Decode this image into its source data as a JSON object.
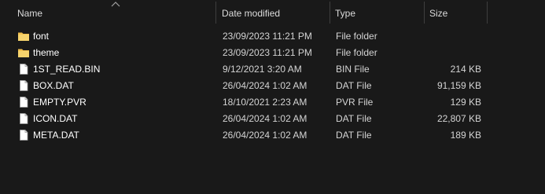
{
  "columns": {
    "name": "Name",
    "date": "Date modified",
    "type": "Type",
    "size": "Size"
  },
  "sort": {
    "column": "name",
    "icon": "chevron-up-icon"
  },
  "colors": {
    "background": "#191919",
    "folder": "#f2c14e",
    "separator": "#3e3e3e"
  },
  "files": [
    {
      "name": "font",
      "date": "23/09/2023 11:21 PM",
      "type": "File folder",
      "size": "",
      "icon": "folder-icon"
    },
    {
      "name": "theme",
      "date": "23/09/2023 11:21 PM",
      "type": "File folder",
      "size": "",
      "icon": "folder-icon"
    },
    {
      "name": "1ST_READ.BIN",
      "date": "9/12/2021 3:20 AM",
      "type": "BIN File",
      "size": "214 KB",
      "icon": "file-icon"
    },
    {
      "name": "BOX.DAT",
      "date": "26/04/2024 1:02 AM",
      "type": "DAT File",
      "size": "91,159 KB",
      "icon": "file-icon"
    },
    {
      "name": "EMPTY.PVR",
      "date": "18/10/2021 2:23 AM",
      "type": "PVR File",
      "size": "129 KB",
      "icon": "file-icon"
    },
    {
      "name": "ICON.DAT",
      "date": "26/04/2024 1:02 AM",
      "type": "DAT File",
      "size": "22,807 KB",
      "icon": "file-icon"
    },
    {
      "name": "META.DAT",
      "date": "26/04/2024 1:02 AM",
      "type": "DAT File",
      "size": "189 KB",
      "icon": "file-icon"
    }
  ]
}
